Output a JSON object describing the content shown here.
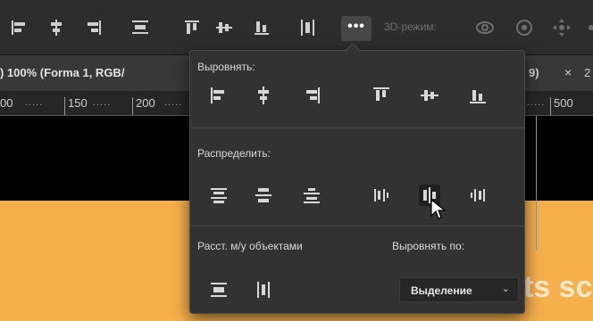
{
  "optionsBar": {
    "more_label": "•••",
    "mode3d_label": "3D-режим:"
  },
  "document": {
    "title": ") 100% (Forma 1, RGB/",
    "tail": "9)",
    "close": "×",
    "tail2": "2"
  },
  "ruler": {
    "labels": [
      "00",
      "150",
      "200",
      "500"
    ],
    "dots": "....."
  },
  "canvas": {
    "text": "ts sc",
    "background": "#f5b04c"
  },
  "panel": {
    "align_title": "Выровнять:",
    "distribute_title": "Распределить:",
    "spacing_title": "Расст. м/у объектами",
    "align_to_title": "Выровнять по:",
    "align_to_value": "Выделение",
    "select_chevron": "⌄"
  }
}
